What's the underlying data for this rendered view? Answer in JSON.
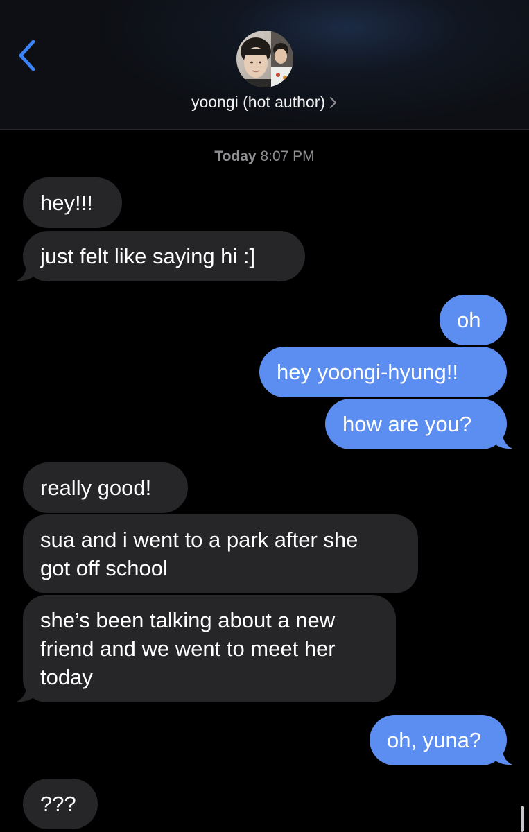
{
  "header": {
    "contact_name": "yoongi (hot author)",
    "back_icon": "chevron-left-icon",
    "detail_icon": "chevron-right-icon",
    "avatar": "contact-avatar-photo"
  },
  "thread": {
    "timestamp_day": "Today",
    "timestamp_time": "8:07 PM"
  },
  "messages": [
    {
      "from": "contact",
      "text": "hey!!!"
    },
    {
      "from": "contact",
      "text": "just felt like saying hi :]"
    },
    {
      "from": "me",
      "text": "oh"
    },
    {
      "from": "me",
      "text": "hey yoongi-hyung!!"
    },
    {
      "from": "me",
      "text": "how are you?"
    },
    {
      "from": "contact",
      "text": "really good!"
    },
    {
      "from": "contact",
      "lines": [
        "sua and i went to a park after she",
        "got off school"
      ]
    },
    {
      "from": "contact",
      "lines": [
        "she’s been talking about a new",
        "friend and we went to meet her",
        "today"
      ]
    },
    {
      "from": "me",
      "text": "oh, yuna?"
    },
    {
      "from": "contact",
      "text": "???"
    }
  ],
  "colors": {
    "incoming_bubble": "#262629",
    "outgoing_bubble": "#5b8ef0",
    "accent": "#3b82f6",
    "timestamp": "#8e8e93"
  }
}
